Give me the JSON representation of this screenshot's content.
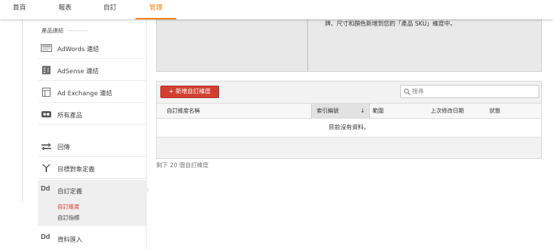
{
  "topnav": {
    "tabs": [
      {
        "label": "首頁",
        "active": false
      },
      {
        "label": "報表",
        "active": false
      },
      {
        "label": "自訂",
        "active": false
      },
      {
        "label": "管理",
        "active": true
      }
    ]
  },
  "sidebar": {
    "section_label": "產品連結",
    "items": [
      {
        "label": "AdWords 連結",
        "icon": "adwords-icon"
      },
      {
        "label": "AdSense 連結",
        "icon": "adsense-icon"
      },
      {
        "label": "Ad Exchange 連結",
        "icon": "ad-exchange-icon"
      },
      {
        "label": "所有產品",
        "icon": "all-products-icon"
      },
      {
        "label": "回傳",
        "icon": "postbacks-icon"
      },
      {
        "label": "目標對象定義",
        "icon": "audience-icon"
      },
      {
        "label": "自訂定義",
        "icon": "dd-icon",
        "icon_text": "Dd"
      },
      {
        "label": "資料匯入",
        "icon": "dd-icon",
        "icon_text": "Dd"
      }
    ],
    "subitems": [
      {
        "label": "自訂維度",
        "active": true
      },
      {
        "label": "自訂指標",
        "active": false
      }
    ]
  },
  "main": {
    "panel_text": "牌、尺寸和顏色新增到您的「產品 SKU」維度中。",
    "add_button": "+ 新增自訂維度",
    "search_placeholder": "搜尋",
    "columns": [
      "自訂維度名稱",
      "索引編號",
      "範圍",
      "上次修改日期",
      "狀態"
    ],
    "sort_indicator": "↓",
    "empty_message": "目前沒有資料。",
    "remaining": "剩下 20 個自訂維度"
  },
  "colors": {
    "accent": "#f57c00",
    "button": "#d23f31",
    "active_sub": "#d23f31"
  }
}
